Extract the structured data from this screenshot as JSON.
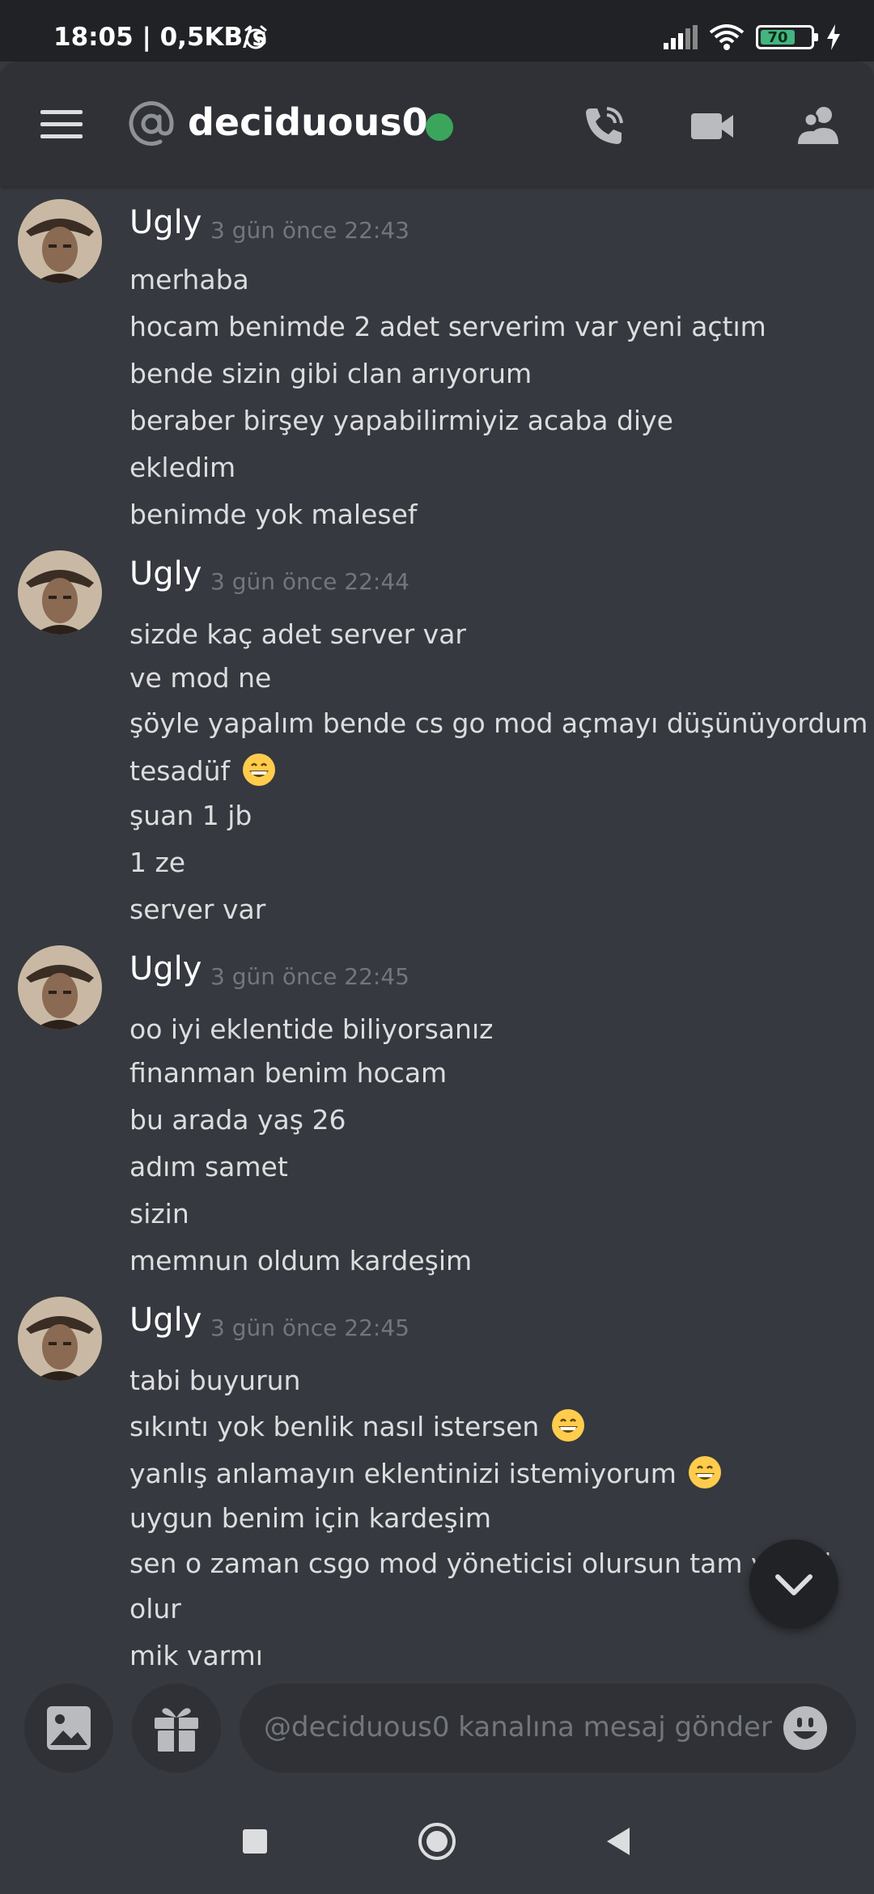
{
  "status_bar": {
    "time": "18:05 | 0,5KB/s",
    "battery": "70",
    "icons": [
      "alarm-icon",
      "signal-icon",
      "wifi-icon",
      "battery-icon",
      "charging-icon"
    ]
  },
  "header": {
    "channel_name": "deciduous0",
    "status_color": "#3ba55c",
    "icons": [
      "menu-icon",
      "at-icon",
      "call-icon",
      "video-icon",
      "members-icon"
    ]
  },
  "messages": [
    {
      "author": "Ugly",
      "timestamp": "3 gün önce 22:43",
      "lines": [
        "merhaba",
        "hocam benimde 2 adet serverim var yeni açtım",
        "bende sizin gibi clan arıyorum",
        "beraber birşey yapabilirmiyiz acaba diye",
        "ekledim",
        "benimde yok malesef"
      ]
    },
    {
      "author": "Ugly",
      "timestamp": "3 gün önce 22:44",
      "lines": [
        "sizde kaç adet server var",
        "ve mod ne",
        "şöyle yapalım bende cs go mod açmayı düşünüyordum",
        "tesadüf",
        "şuan 1 jb",
        "1 ze",
        "server var"
      ]
    },
    {
      "author": "Ugly",
      "timestamp": "3 gün önce 22:45",
      "lines": [
        "oo iyi eklentide biliyorsanız",
        "finanman benim hocam",
        "bu arada yaş 26",
        "adım samet",
        "sizin",
        "memnun oldum kardeşim"
      ]
    },
    {
      "author": "Ugly",
      "timestamp": "3 gün önce 22:45",
      "lines": [
        "tabi buyurun",
        "sıkıntı yok benlik nasıl istersen",
        "yanlış anlamayın eklentinizi istemiyorum",
        "uygun benim için kardeşim",
        "sen o zaman csgo mod yöneticisi olursun tam yetkili",
        "olur",
        "mik varmı"
      ]
    }
  ],
  "composer": {
    "placeholder": "@deciduous0 kanalına mesaj gönder",
    "icons": [
      "image-icon",
      "gift-icon",
      "emoji-icon"
    ]
  },
  "colors": {
    "background": "#36393f",
    "header": "#2f3136",
    "statusbar": "#202225",
    "text": "#dcddde",
    "muted": "#72767d"
  }
}
